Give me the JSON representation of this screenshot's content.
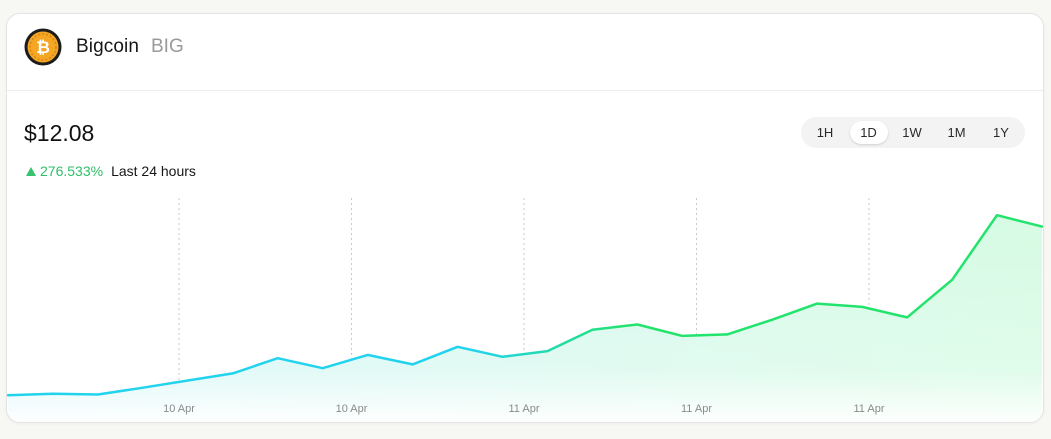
{
  "coin": {
    "name": "Bigcoin",
    "ticker": "BIG",
    "logo_icon": "bitcoin-coin-icon",
    "logo_color": "#f5a623"
  },
  "price": "$12.08",
  "change": {
    "direction_icon": "up-triangle-icon",
    "percent": "276.533%",
    "period": "Last 24 hours",
    "color": "#2fbe69"
  },
  "range_tabs": [
    {
      "label": "1H",
      "active": false
    },
    {
      "label": "1D",
      "active": true
    },
    {
      "label": "1W",
      "active": false
    },
    {
      "label": "1M",
      "active": false
    },
    {
      "label": "1Y",
      "active": false
    }
  ],
  "colors": {
    "line_start": "#22d3ee",
    "line_end": "#22e36b",
    "area_start": "#d9f7fb",
    "area_end": "#d6fbe3"
  },
  "chart_data": {
    "type": "area",
    "x_tick_labels": [
      "10 Apr",
      "10 Apr",
      "11 Apr",
      "11 Apr",
      "11 Apr"
    ],
    "values": [
      1.0,
      1.3,
      1.15,
      2.6,
      4.1,
      5.6,
      8.8,
      6.7,
      9.5,
      7.5,
      11.2,
      9.1,
      10.3,
      14.8,
      15.9,
      13.5,
      13.8,
      16.9,
      20.3,
      19.6,
      17.4,
      25.3,
      38.9,
      36.5
    ],
    "y_range": [
      0,
      40
    ],
    "grid": "vertical dashed lines at x ticks"
  }
}
